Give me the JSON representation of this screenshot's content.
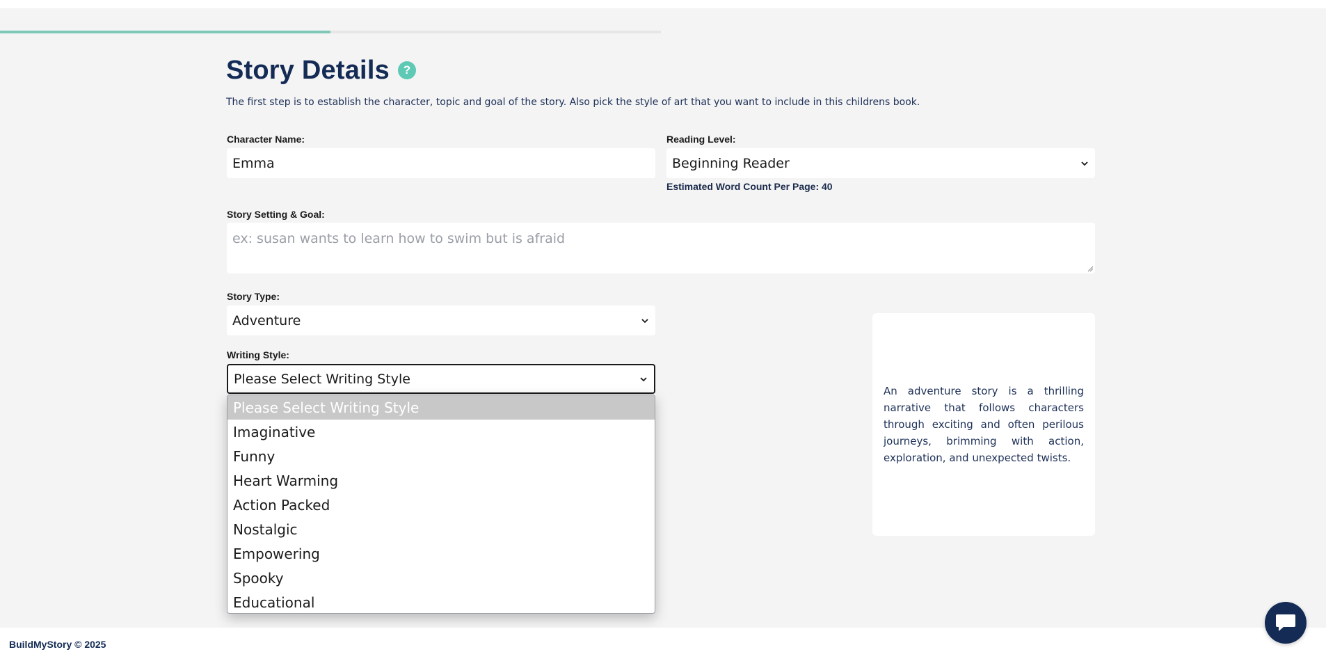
{
  "progress": {
    "fraction": 0.5
  },
  "header": {
    "title": "Story Details",
    "help_icon_glyph": "?",
    "subtitle": "The first step is to establish the character, topic and goal of the story. Also pick the style of art that you want to include in this childrens book."
  },
  "form": {
    "character_name": {
      "label": "Character Name:",
      "value": "Emma"
    },
    "reading_level": {
      "label": "Reading Level:",
      "value": "Beginning Reader",
      "hint": "Estimated Word Count Per Page: 40"
    },
    "story_setting": {
      "label": "Story Setting & Goal:",
      "placeholder": "ex: susan wants to learn how to swim but is afraid"
    },
    "story_type": {
      "label": "Story Type:",
      "value": "Adventure"
    },
    "writing_style": {
      "label": "Writing Style:",
      "value": "Please Select Writing Style",
      "options": [
        "Please Select Writing Style",
        "Imaginative",
        "Funny",
        "Heart Warming",
        "Action Packed",
        "Nostalgic",
        "Empowering",
        "Spooky",
        "Educational"
      ]
    }
  },
  "description_card": {
    "text": "An adventure story is a thrilling narrative that follows characters through exciting and often perilous journeys, brimming with action, exploration, and unexpected twists."
  },
  "footer": {
    "text": "BuildMyStory © 2025"
  },
  "colors": {
    "accent": "#5ec9b5",
    "progress": "#7fc8b7",
    "navy": "#132b55"
  },
  "icons": {
    "help": "question-circle-icon",
    "chevron": "chevron-down-icon",
    "chat": "chat-bubble-icon"
  }
}
